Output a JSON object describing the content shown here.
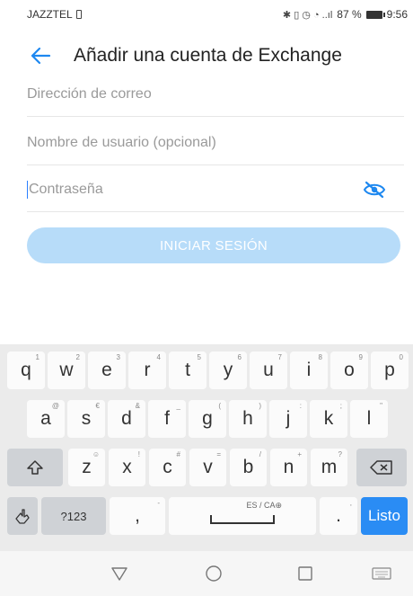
{
  "status_bar": {
    "carrier": "JAZZTEL",
    "indicators": "✱ ▯ ◷ ◔ ..ıl",
    "battery_percent": "87 %",
    "time": "9:56"
  },
  "app_bar": {
    "title": "Añadir una cuenta de Exchange"
  },
  "form": {
    "email_placeholder": "Dirección de correo",
    "username_placeholder": "Nombre de usuario (opcional)",
    "password_placeholder": "Contraseña",
    "login_button": "INICIAR SESIÓN"
  },
  "keyboard": {
    "row1": [
      {
        "k": "q",
        "h": "1"
      },
      {
        "k": "w",
        "h": "2"
      },
      {
        "k": "e",
        "h": "3"
      },
      {
        "k": "r",
        "h": "4"
      },
      {
        "k": "t",
        "h": "5"
      },
      {
        "k": "y",
        "h": "6"
      },
      {
        "k": "u",
        "h": "7"
      },
      {
        "k": "i",
        "h": "8"
      },
      {
        "k": "o",
        "h": "9"
      },
      {
        "k": "p",
        "h": "0"
      }
    ],
    "row2": [
      {
        "k": "a",
        "h": "@"
      },
      {
        "k": "s",
        "h": "€"
      },
      {
        "k": "d",
        "h": "&"
      },
      {
        "k": "f",
        "h": "_"
      },
      {
        "k": "g",
        "h": "("
      },
      {
        "k": "h",
        "h": ")"
      },
      {
        "k": "j",
        "h": ":"
      },
      {
        "k": "k",
        "h": ";"
      },
      {
        "k": "l",
        "h": "\""
      }
    ],
    "row3": [
      {
        "k": "z",
        "h": "☺"
      },
      {
        "k": "x",
        "h": "!"
      },
      {
        "k": "c",
        "h": "#"
      },
      {
        "k": "v",
        "h": "="
      },
      {
        "k": "b",
        "h": "/"
      },
      {
        "k": "n",
        "h": "+"
      },
      {
        "k": "m",
        "h": "?"
      }
    ],
    "symbols_key": "?123",
    "comma_key": ",",
    "comma_hint": "-",
    "space_label": "ES / CA⊕",
    "period_key": ".",
    "period_hint": ",",
    "done_key": "Listo"
  },
  "colors": {
    "accent": "#2a8cf4",
    "button_disabled": "#b7dcf9"
  }
}
